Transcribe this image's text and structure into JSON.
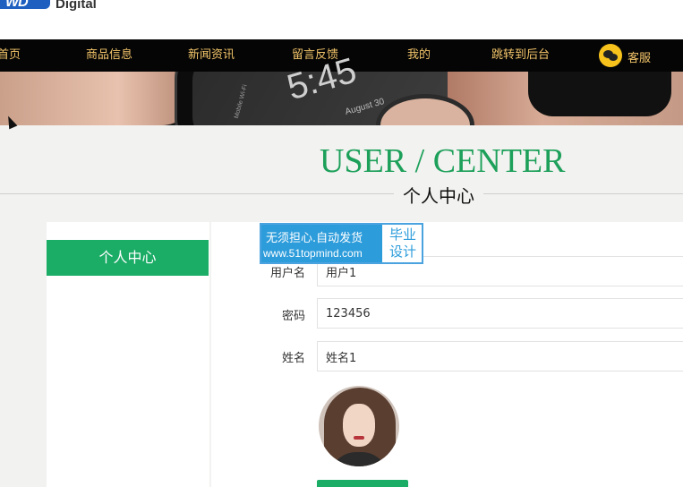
{
  "header": {
    "logo_mark": "WD",
    "logo_text": "Digital"
  },
  "nav": {
    "items": [
      "首页",
      "商品信息",
      "新闻资讯",
      "留言反馈",
      "我的",
      "跳转到后台"
    ],
    "service_label": "客服",
    "service_icon": "wechat-icon",
    "text_color": "#f3c56a",
    "background": "#050505"
  },
  "banner": {
    "time": "5:45",
    "date": "August 30",
    "carrier": "Mobile Wi-Fi"
  },
  "page": {
    "title_en": "USER / CENTER",
    "title_cn": "个人中心",
    "accent_color": "#1da05a"
  },
  "sidebar": {
    "items": [
      {
        "label": "个人中心",
        "active": true
      }
    ],
    "active_color": "#1bac66"
  },
  "form": {
    "fields": [
      {
        "label": "用户名",
        "value": "用户1"
      },
      {
        "label": "密码",
        "value": "123456"
      },
      {
        "label": "姓名",
        "value": "姓名1"
      }
    ],
    "avatar_icon": "user-avatar-photo"
  },
  "watermark": {
    "line1": "无须担心.自动发货",
    "line2": "www.51topmind.com",
    "badge_line1": "毕业",
    "badge_line2": "设计"
  }
}
